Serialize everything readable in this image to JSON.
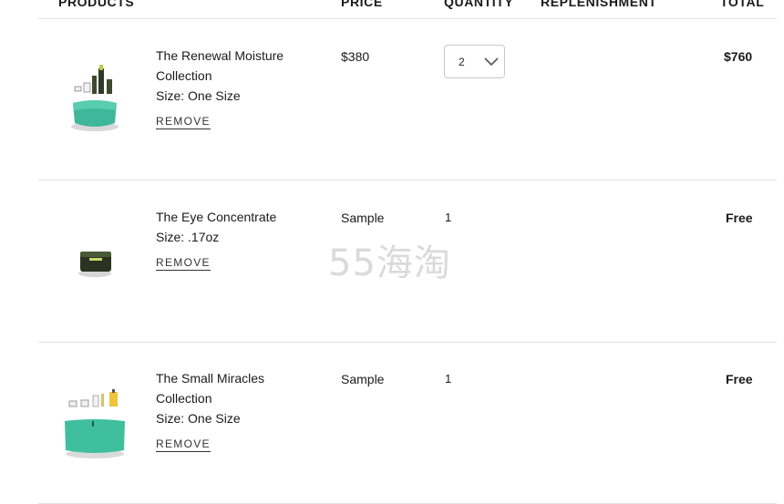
{
  "header": {
    "products": "PRODUCTS",
    "price": "PRICE",
    "quantity": "QUANTITY",
    "replenishment": "REPLENISHMENT",
    "total": "TOTAL"
  },
  "items": [
    {
      "name": "The Renewal Moisture Collection",
      "size": "Size: One Size",
      "remove": "REMOVE",
      "price": "$380",
      "quantity": "2",
      "total": "$760",
      "image_icon": "moisture-collection-kit-icon"
    },
    {
      "name": "The Eye Concentrate",
      "size": "Size: .17oz",
      "remove": "REMOVE",
      "price": "Sample",
      "quantity": "1",
      "total": "Free",
      "image_icon": "eye-cream-jar-icon"
    },
    {
      "name": "The Small Miracles Collection",
      "size": "Size: One Size",
      "remove": "REMOVE",
      "price": "Sample",
      "quantity": "1",
      "total": "Free",
      "image_icon": "miracles-collection-kit-icon"
    }
  ],
  "watermark": "55海淘",
  "colors": {
    "accent_teal": "#3fbf9e",
    "text": "#1a1a1a",
    "divider": "#e2e2e2"
  }
}
